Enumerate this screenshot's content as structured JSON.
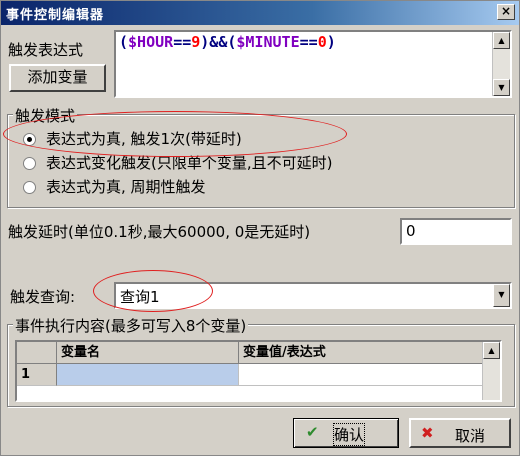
{
  "window": {
    "title": "事件控制编辑器",
    "close_glyph": "×"
  },
  "expression": {
    "label": "触发表达式",
    "add_var_button": "添加变量",
    "text_parts": [
      {
        "text": "(",
        "color": "#000080"
      },
      {
        "text": "$HOUR",
        "color": "#8000c0"
      },
      {
        "text": "==",
        "color": "#000080"
      },
      {
        "text": "9",
        "color": "#ff0000"
      },
      {
        "text": ")&&(",
        "color": "#000080"
      },
      {
        "text": "$MINUTE",
        "color": "#8000c0"
      },
      {
        "text": "==",
        "color": "#000080"
      },
      {
        "text": "0",
        "color": "#ff0000"
      },
      {
        "text": ")",
        "color": "#000080"
      }
    ]
  },
  "trigger_mode": {
    "legend": "触发模式",
    "options": [
      {
        "label": "表达式为真, 触发1次(带延时)",
        "selected": true
      },
      {
        "label": "表达式变化触发(只限单个变量,且不可延时)",
        "selected": false
      },
      {
        "label": "表达式为真, 周期性触发",
        "selected": false
      }
    ]
  },
  "delay": {
    "label": "触发延时(单位0.1秒,最大60000, 0是无延时)",
    "value": "0"
  },
  "query": {
    "label": "触发查询:",
    "value": "查询1"
  },
  "exec": {
    "legend": "事件执行内容(最多可写入8个变量)",
    "headers": [
      "",
      "变量名",
      "变量值/表达式"
    ],
    "rows": [
      {
        "num": "1",
        "name": "",
        "value": ""
      }
    ]
  },
  "buttons": {
    "ok": "确认",
    "cancel": "取消"
  },
  "colors": {
    "annotation": "#e02020",
    "selected_cell": "#b9cdea"
  }
}
